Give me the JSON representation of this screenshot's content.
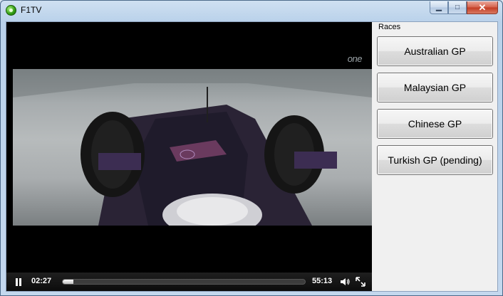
{
  "window": {
    "title": "F1TV"
  },
  "caption_buttons": {
    "minimize_glyph": "▁",
    "maximize_glyph": "□",
    "close_glyph": "✕"
  },
  "video": {
    "channel_logo": "one",
    "current_time": "02:27",
    "total_time": "55:13",
    "progress": 0.044
  },
  "sidebar": {
    "heading": "Races",
    "races": [
      {
        "label": "Australian GP"
      },
      {
        "label": "Malaysian GP"
      },
      {
        "label": "Chinese GP"
      },
      {
        "label": "Turkish GP (pending)"
      }
    ]
  },
  "colors": {
    "title_bar": "#c4d8ee",
    "video_bg": "#000000",
    "panel_bg": "#f0f0f0"
  }
}
